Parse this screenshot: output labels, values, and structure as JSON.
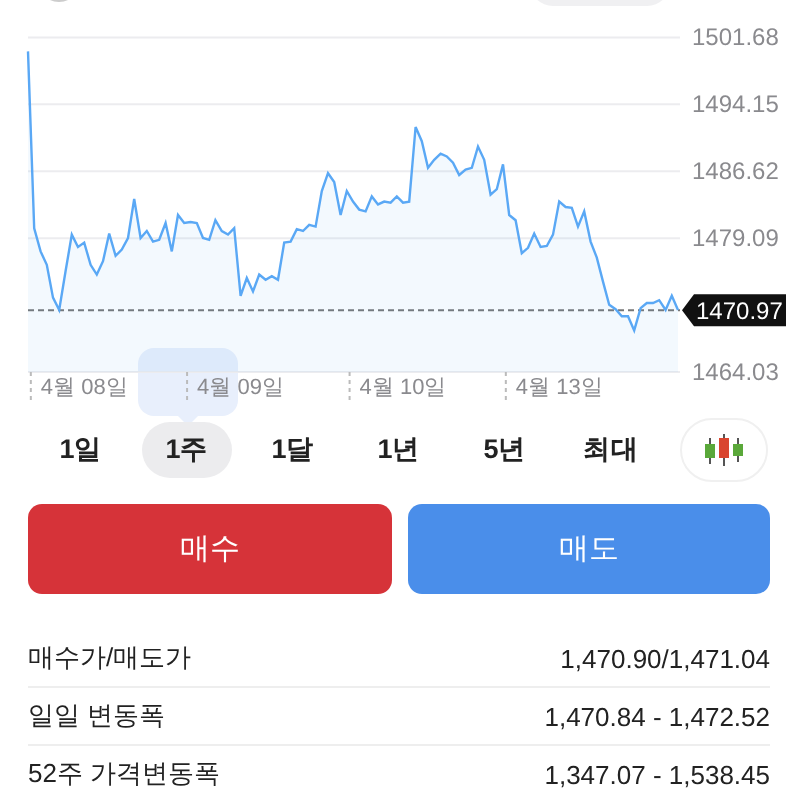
{
  "chart": {
    "chart_data": {
      "type": "area",
      "grid": true,
      "ylim": [
        1464.03,
        1501.68
      ],
      "categories": [
        null,
        null,
        null,
        null,
        null,
        null,
        null,
        null,
        null,
        "4월 08일",
        null,
        null,
        null,
        null,
        null,
        null,
        null,
        null,
        null,
        null,
        null,
        null,
        null,
        null,
        null,
        null,
        null,
        null,
        null,
        null,
        null,
        null,
        null,
        null,
        "4월 09일",
        null,
        null,
        null,
        null,
        null,
        null,
        null,
        null,
        null,
        null,
        null,
        null,
        null,
        null,
        null,
        null,
        null,
        null,
        null,
        null,
        null,
        null,
        null,
        null,
        null,
        "4월 10일",
        null,
        null,
        null,
        null,
        null,
        null,
        null,
        null,
        null,
        null,
        null,
        null,
        null,
        null,
        null,
        null,
        null,
        null,
        null,
        null,
        null,
        null,
        null,
        null,
        "4월 13일",
        null,
        null,
        null,
        null,
        null,
        null,
        null,
        null,
        null,
        null,
        null,
        null,
        null,
        null,
        null,
        null,
        null,
        null,
        null
      ],
      "yticks": [
        1501.68,
        1494.15,
        1486.62,
        1479.09,
        1464.03
      ],
      "series": [
        {
          "color": "#5aa8f5",
          "values": [
            1500.1,
            1480.2,
            1477.6,
            1476.1,
            1472.4,
            1471.0,
            1475.4,
            1479.5,
            1478.1,
            1478.6,
            1476.1,
            1475.0,
            1476.5,
            1479.6,
            1477.1,
            1477.8,
            1479.1,
            1483.5,
            1479.1,
            1479.9,
            1478.7,
            1478.9,
            1480.8,
            1477.6,
            1481.7,
            1480.8,
            1480.9,
            1480.8,
            1479.1,
            1478.9,
            1481.1,
            1479.9,
            1479.5,
            1480.2,
            1472.6,
            1474.6,
            1473.1,
            1475.0,
            1474.4,
            1474.8,
            1474.4,
            1478.6,
            1478.7,
            1480.1,
            1479.9,
            1480.6,
            1480.4,
            1484.4,
            1486.4,
            1485.4,
            1481.7,
            1484.4,
            1483.2,
            1482.3,
            1482.1,
            1483.8,
            1482.9,
            1483.2,
            1483.1,
            1483.8,
            1483.1,
            1483.2,
            1491.6,
            1490.0,
            1487.0,
            1487.9,
            1488.6,
            1488.3,
            1487.6,
            1486.2,
            1486.8,
            1487.0,
            1489.4,
            1487.9,
            1484.0,
            1484.6,
            1487.4,
            1481.7,
            1481.1,
            1477.4,
            1478.0,
            1479.6,
            1478.1,
            1478.2,
            1479.5,
            1483.2,
            1482.6,
            1482.5,
            1480.4,
            1482.1,
            1478.7,
            1476.9,
            1474.2,
            1471.6,
            1471.1,
            1470.3,
            1470.3,
            1468.7,
            1471.2,
            1471.8,
            1471.8,
            1472.1,
            1471.0,
            1472.6,
            1471.0
          ]
        }
      ],
      "ref_lines": [
        {
          "axis": "y",
          "value": 1470.97,
          "label": "1470.97"
        }
      ]
    }
  },
  "ranges": [
    {
      "label": "1일",
      "selected": false
    },
    {
      "label": "1주",
      "selected": true
    },
    {
      "label": "1달",
      "selected": false
    },
    {
      "label": "1년",
      "selected": false
    },
    {
      "label": "5년",
      "selected": false
    },
    {
      "label": "최대",
      "selected": false
    }
  ],
  "actions": [
    {
      "kind": "buy",
      "label": "매수"
    },
    {
      "kind": "sell",
      "label": "매도"
    }
  ],
  "stats": [
    {
      "label": "매수가/매도가",
      "value": "1,470.90/1,471.04"
    },
    {
      "label": "일일 변동폭",
      "value": "1,470.84 - 1,472.52"
    },
    {
      "label": "52주 가격변동폭",
      "value": "1,347.07 - 1,538.45"
    }
  ]
}
